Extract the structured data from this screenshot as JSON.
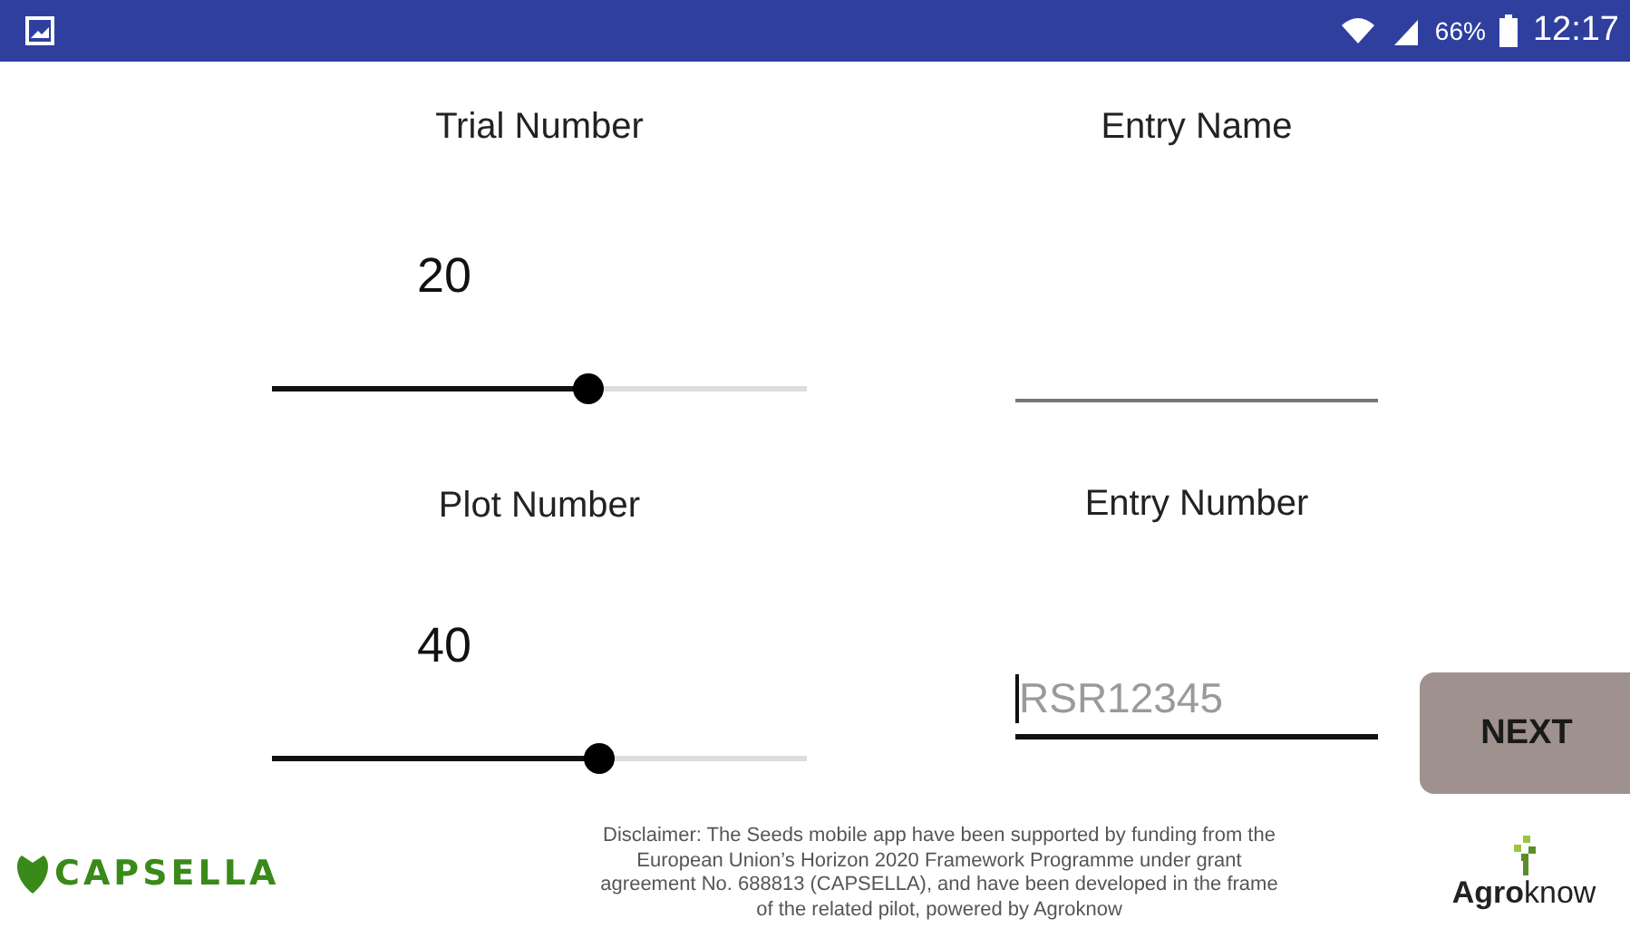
{
  "status_bar": {
    "battery": "66%",
    "time": "12:17"
  },
  "trial": {
    "label": "Trial Number",
    "value": "20",
    "level": 0.59
  },
  "plot": {
    "label": "Plot Number",
    "value": "40",
    "level": 0.61
  },
  "entry_name": {
    "label": "Entry Name"
  },
  "entry_number": {
    "label": "Entry Number",
    "placeholder": "RSR12345",
    "focused": true
  },
  "next_button": "NEXT",
  "footer": {
    "logo_left": "CAPSELLA",
    "disclaimer": "Disclaimer: The Seeds mobile app have been supported by funding from the European Union’s Horizon 2020 Framework Programme under grant agreement No. 688813 (CAPSELLA), and have been developed in the frame of the related pilot, powered by Agroknow",
    "logo_right": "**Agro**know"
  }
}
